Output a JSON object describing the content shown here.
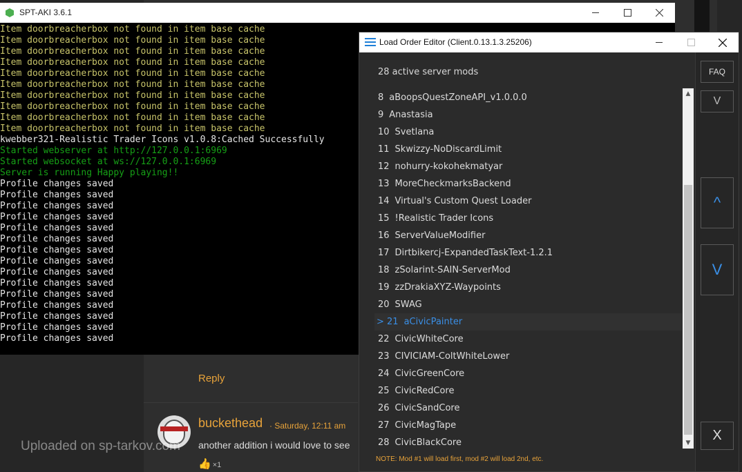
{
  "forum": {
    "reply_label": "Reply",
    "author": "buckethead",
    "post_date": "· Saturday, 12:11 am",
    "post_text": "another addition i would love to see",
    "like_count": "×1",
    "watermark": "Uploaded on sp-tarkov.com"
  },
  "console": {
    "title": "SPT-AKI 3.6.1",
    "lines": [
      {
        "text": "Item doorbreacherbox not found in item base cache",
        "color": "yellow"
      },
      {
        "text": "Item doorbreacherbox not found in item base cache",
        "color": "yellow"
      },
      {
        "text": "Item doorbreacherbox not found in item base cache",
        "color": "yellow"
      },
      {
        "text": "Item doorbreacherbox not found in item base cache",
        "color": "yellow"
      },
      {
        "text": "Item doorbreacherbox not found in item base cache",
        "color": "yellow"
      },
      {
        "text": "Item doorbreacherbox not found in item base cache",
        "color": "yellow"
      },
      {
        "text": "Item doorbreacherbox not found in item base cache",
        "color": "yellow"
      },
      {
        "text": "Item doorbreacherbox not found in item base cache",
        "color": "yellow"
      },
      {
        "text": "Item doorbreacherbox not found in item base cache",
        "color": "yellow"
      },
      {
        "text": "Item doorbreacherbox not found in item base cache",
        "color": "yellow"
      },
      {
        "text": "kwebber321-Realistic Trader Icons v1.0.8:Cached Successfully",
        "color": "white"
      },
      {
        "text": "Started webserver at http://127.0.0.1:6969",
        "color": "green"
      },
      {
        "text": "Started websocket at ws://127.0.0.1:6969",
        "color": "green"
      },
      {
        "text": "Server is running Happy playing!!",
        "color": "green"
      },
      {
        "text": "Profile changes saved",
        "color": "white"
      },
      {
        "text": "Profile changes saved",
        "color": "white"
      },
      {
        "text": "Profile changes saved",
        "color": "white"
      },
      {
        "text": "Profile changes saved",
        "color": "white"
      },
      {
        "text": "Profile changes saved",
        "color": "white"
      },
      {
        "text": "Profile changes saved",
        "color": "white"
      },
      {
        "text": "Profile changes saved",
        "color": "white"
      },
      {
        "text": "Profile changes saved",
        "color": "white"
      },
      {
        "text": "Profile changes saved",
        "color": "white"
      },
      {
        "text": "Profile changes saved",
        "color": "white"
      },
      {
        "text": "Profile changes saved",
        "color": "white"
      },
      {
        "text": "Profile changes saved",
        "color": "white"
      },
      {
        "text": "Profile changes saved",
        "color": "white"
      },
      {
        "text": "Profile changes saved",
        "color": "white"
      },
      {
        "text": "Profile changes saved",
        "color": "white"
      }
    ]
  },
  "editor": {
    "title": "Load Order Editor (Client.0.13.1.3.25206)",
    "mods_count": "28 active server mods",
    "mods": [
      {
        "num": "8",
        "name": "aBoopsQuestZoneAPI_v1.0.0.0",
        "selected": false
      },
      {
        "num": "9",
        "name": "Anastasia",
        "selected": false
      },
      {
        "num": "10",
        "name": "Svetlana",
        "selected": false
      },
      {
        "num": "11",
        "name": "Skwizzy-NoDiscardLimit",
        "selected": false
      },
      {
        "num": "12",
        "name": "nohurry-kokohekmatyar",
        "selected": false
      },
      {
        "num": "13",
        "name": "MoreCheckmarksBackend",
        "selected": false
      },
      {
        "num": "14",
        "name": "Virtual's Custom Quest Loader",
        "selected": false
      },
      {
        "num": "15",
        "name": "!Realistic Trader Icons",
        "selected": false
      },
      {
        "num": "16",
        "name": "ServerValueModifier",
        "selected": false
      },
      {
        "num": "17",
        "name": "Dirtbikercj-ExpandedTaskText-1.2.1",
        "selected": false
      },
      {
        "num": "18",
        "name": "zSolarint-SAIN-ServerMod",
        "selected": false
      },
      {
        "num": "19",
        "name": "zzDrakiaXYZ-Waypoints",
        "selected": false
      },
      {
        "num": "20",
        "name": "SWAG",
        "selected": false
      },
      {
        "num": "> 21",
        "name": "aCivicPainter",
        "selected": true
      },
      {
        "num": "22",
        "name": "CivicWhiteCore",
        "selected": false
      },
      {
        "num": "23",
        "name": "CIVICIAM-ColtWhiteLower",
        "selected": false
      },
      {
        "num": "24",
        "name": "CivicGreenCore",
        "selected": false
      },
      {
        "num": "25",
        "name": "CivicRedCore",
        "selected": false
      },
      {
        "num": "26",
        "name": "CivicSandCore",
        "selected": false
      },
      {
        "num": "27",
        "name": "CivicMagTape",
        "selected": false
      },
      {
        "num": "28",
        "name": "CivicBlackCore",
        "selected": false
      }
    ],
    "faq_label": "FAQ",
    "move_bottom_label": "V",
    "move_up_label": "^",
    "move_down_label": "V",
    "close_label": "X",
    "note": "NOTE: Mod #1 will load first, mod #2 will load 2nd, etc."
  },
  "colors": {
    "accent_blue": "#3a8fe6",
    "accent_orange": "#e8a33a"
  }
}
